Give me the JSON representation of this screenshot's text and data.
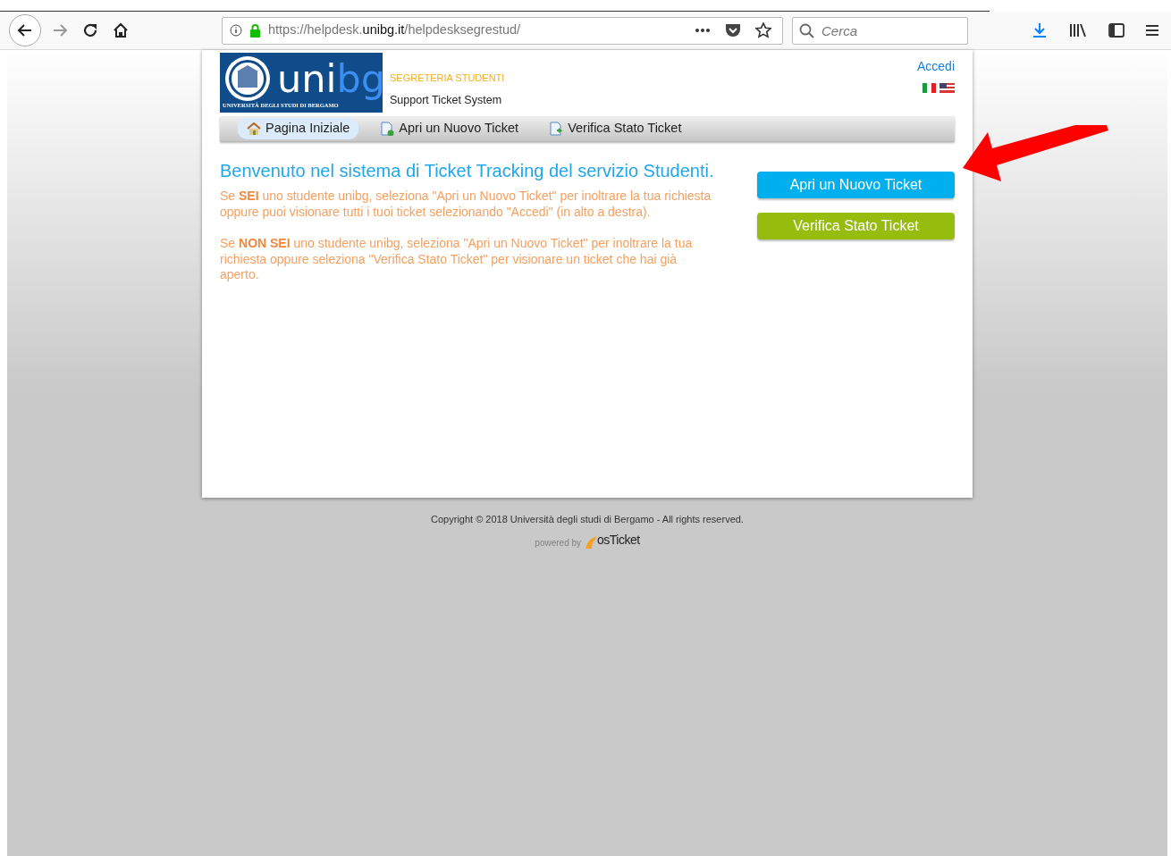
{
  "browser": {
    "url": {
      "prefix": "https://helpdesk.",
      "domain": "unibg.it",
      "path": "/helpdesksegrestud/"
    },
    "search": {
      "placeholder": "Cerca"
    }
  },
  "header": {
    "logo": {
      "word_1": "uni",
      "word_2": "bg",
      "tagline": "UNIVERSITÀ DEGLI STUDI DI BERGAMO"
    },
    "department": "SEGRETERIA STUDENTI",
    "system": "Support Ticket System",
    "login_link": "Accedi",
    "languages": [
      {
        "kind": "italian"
      },
      {
        "kind": "english"
      }
    ]
  },
  "nav": [
    {
      "label": "Pagina Iniziale",
      "kind": "home",
      "selected": true
    },
    {
      "label": "Apri un Nuovo Ticket",
      "kind": "new",
      "selected": false
    },
    {
      "label": "Verifica Stato Ticket",
      "kind": "check",
      "selected": false
    }
  ],
  "welcome": {
    "title": "Benvenuto nel sistema di Ticket Tracking del servizio Studenti.",
    "paragraphs": [
      "Se **SEI** uno studente unibg, seleziona \"Apri un Nuovo Ticket\" per inoltrare la tua richiesta oppure puoi visionare tutti i tuoi ticket selezionando \"Accedi\" (in alto a destra).",
      "Se **NON SEI** uno studente unibg, seleziona \"Apri un Nuovo Ticket\" per inoltrare la tua richiesta oppure seleziona \"Verifica Stato Ticket\" per visionare un ticket che hai già aperto."
    ]
  },
  "actions": [
    {
      "label": "Apri un Nuovo Ticket",
      "kind": "new"
    },
    {
      "label": "Verifica Stato Ticket",
      "kind": "check"
    }
  ],
  "footer": {
    "copyright": "Copyright © 2018 Università degli studi di Bergamo - All rights reserved.",
    "powered_by": "powered by",
    "brand": "osTicket"
  }
}
